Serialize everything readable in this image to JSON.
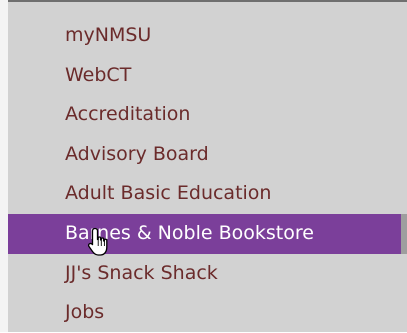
{
  "menu": {
    "items": [
      {
        "label": "myNMSU"
      },
      {
        "label": "WebCT"
      },
      {
        "label": "Accreditation"
      },
      {
        "label": "Advisory Board"
      },
      {
        "label": "Adult Basic Education"
      },
      {
        "label": "Barnes & Noble Bookstore",
        "active": true
      },
      {
        "label": "JJ's Snack Shack"
      },
      {
        "label": "Jobs"
      }
    ]
  },
  "colors": {
    "panel_bg": "#d2d2d2",
    "link": "#6b2b2b",
    "active_bg": "#7b3f9a",
    "active_text": "#ffffff"
  },
  "cursor_icon": "hand-pointer-icon"
}
